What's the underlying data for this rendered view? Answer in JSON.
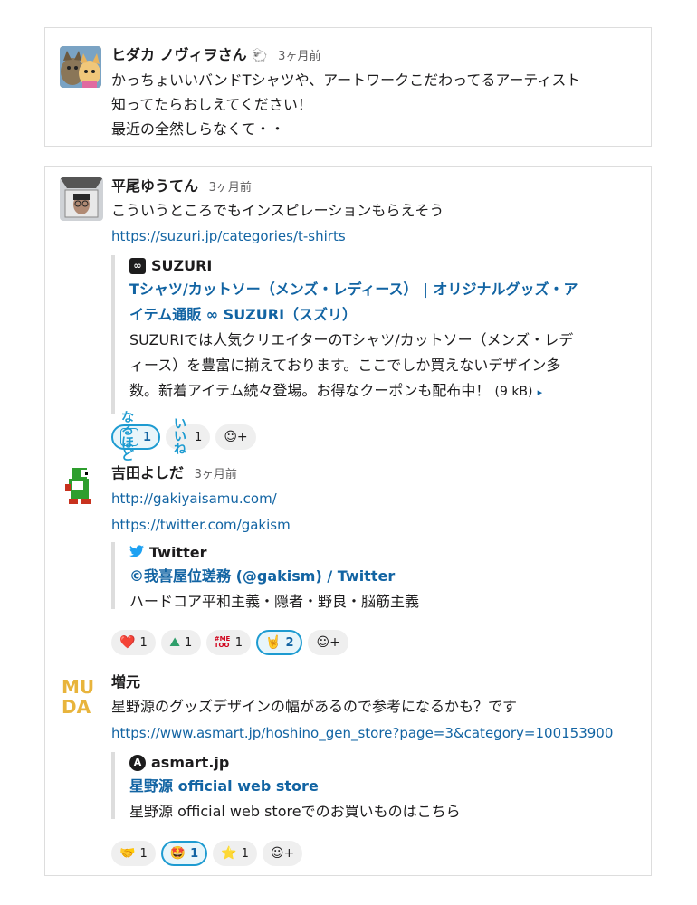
{
  "messages": [
    {
      "author": "ヒダカ ノヴィヲさん",
      "author_emoji": "🐑",
      "time": "3ヶ月前",
      "lines": [
        "かっちょいいバンドTシャツや、アートワークこだわってるアーティスト",
        "知ってたらおしえてください！",
        "最近の全然しらなくて・・"
      ]
    },
    {
      "author": "平尾ゆうてん",
      "time": "3ヶ月前",
      "text": "こういうところでもインスピレーションもらえそう",
      "link": "https://suzuri.jp/categories/t-shirts",
      "unfurl": {
        "source_icon": "∞",
        "source": "SUZURI",
        "title_line1": "Tシャツ/カットソー（メンズ・レディース） | オリジナルグッズ・ア",
        "title_line2": "イテム通販 ∞ SUZURI（スズリ）",
        "desc_line1": "SUZURIでは人気クリエイターのTシャツ/カットソー（メンズ・レデ",
        "desc_line2": "ィース）を豊富に揃えております。ここでしか買えないデザイン多",
        "desc_line3": "数。新着アイテム続々登場。お得なクーポンも配布中！",
        "size": "(9 kB)",
        "caret": "▸"
      },
      "reactions": [
        {
          "emoji": "なる ほど",
          "count": "1",
          "active": true
        },
        {
          "emoji": "いい ね",
          "count": "1",
          "active": false
        }
      ]
    },
    {
      "author": "吉田よしだ",
      "time": "3ヶ月前",
      "link1": "http://gakiyaisamu.com/",
      "link2": "https://twitter.com/gakism",
      "unfurl": {
        "source_icon": "🐦",
        "source": "Twitter",
        "title": "©我喜屋位瑳務 (@gakism) / Twitter",
        "desc": "ハードコア平和主義・隠者・野良・脳筋主義"
      },
      "reactions": [
        {
          "emoji": "❤️",
          "count": "1",
          "active": false
        },
        {
          "emoji": "⛰",
          "count": "1",
          "active": false
        },
        {
          "emoji": "#ME TOO",
          "count": "1",
          "active": false
        },
        {
          "emoji": "🤘",
          "count": "2",
          "active": true
        }
      ]
    },
    {
      "author": "増元",
      "text": "星野源のグッズデザインの幅があるので参考になるかも？です",
      "link": "https://www.asmart.jp/hoshino_gen_store?page=3&category=100153900",
      "unfurl": {
        "source_icon": "A",
        "source": "asmart.jp",
        "title": "星野源 official web store",
        "desc": "星野源 official web storeでのお買いものはこちら"
      },
      "reactions": [
        {
          "emoji": "🤝",
          "count": "1",
          "active": false
        },
        {
          "emoji": "🤩",
          "count": "1",
          "active": true
        },
        {
          "emoji": "⭐",
          "count": "1",
          "active": false
        }
      ]
    }
  ],
  "add_reaction_icon": "☺+",
  "colors": {
    "link": "#1264a3",
    "active_reaction_border": "#1d9bd1",
    "border": "#dddddd"
  }
}
